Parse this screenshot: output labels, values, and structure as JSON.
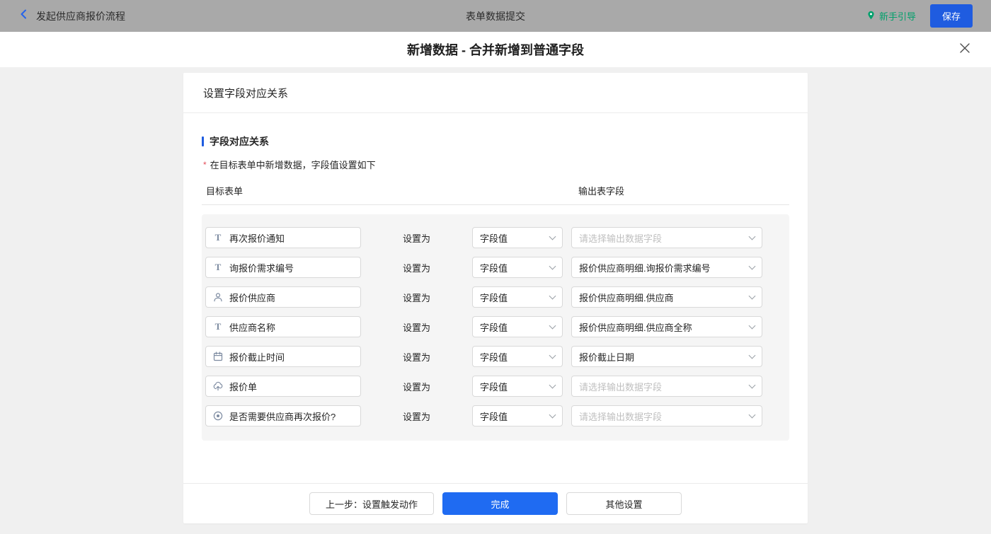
{
  "topbar": {
    "back_label": "发起供应商报价流程",
    "title": "表单数据提交",
    "guide_label": "新手引导",
    "save_label": "保存"
  },
  "dialog": {
    "title": "新增数据 - 合并新增到普通字段"
  },
  "card": {
    "header": "设置字段对应关系",
    "section_title": "字段对应关系",
    "note_marker": "*",
    "note": "在目标表单中新增数据，字段值设置如下",
    "col_left": "目标表单",
    "col_right": "输出表字段",
    "set_as_label": "设置为",
    "rows": [
      {
        "icon": "text",
        "field": "再次报价通知",
        "mode": "字段值",
        "output": "请选择输出数据字段",
        "placeholder": true
      },
      {
        "icon": "text",
        "field": "询报价需求编号",
        "mode": "字段值",
        "output": "报价供应商明细.询报价需求编号",
        "placeholder": false
      },
      {
        "icon": "person",
        "field": "报价供应商",
        "mode": "字段值",
        "output": "报价供应商明细.供应商",
        "placeholder": false
      },
      {
        "icon": "text",
        "field": "供应商名称",
        "mode": "字段值",
        "output": "报价供应商明细.供应商全称",
        "placeholder": false
      },
      {
        "icon": "calendar",
        "field": "报价截止时间",
        "mode": "字段值",
        "output": "报价截止日期",
        "placeholder": false
      },
      {
        "icon": "upload",
        "field": "报价单",
        "mode": "字段值",
        "output": "请选择输出数据字段",
        "placeholder": true
      },
      {
        "icon": "radio",
        "field": "是否需要供应商再次报价?",
        "mode": "字段值",
        "output": "请选择输出数据字段",
        "placeholder": true
      }
    ],
    "footer": {
      "prev_label": "上一步：设置触发动作",
      "done_label": "完成",
      "other_label": "其他设置"
    }
  },
  "colors": {
    "accent_blue": "#1f5ce0",
    "primary_blue": "#1f6bf2",
    "guide_green": "#00a06b",
    "required_red": "#e34d59",
    "topbar_gray": "#a9a9a9",
    "panel_gray": "#f5f5f5"
  }
}
